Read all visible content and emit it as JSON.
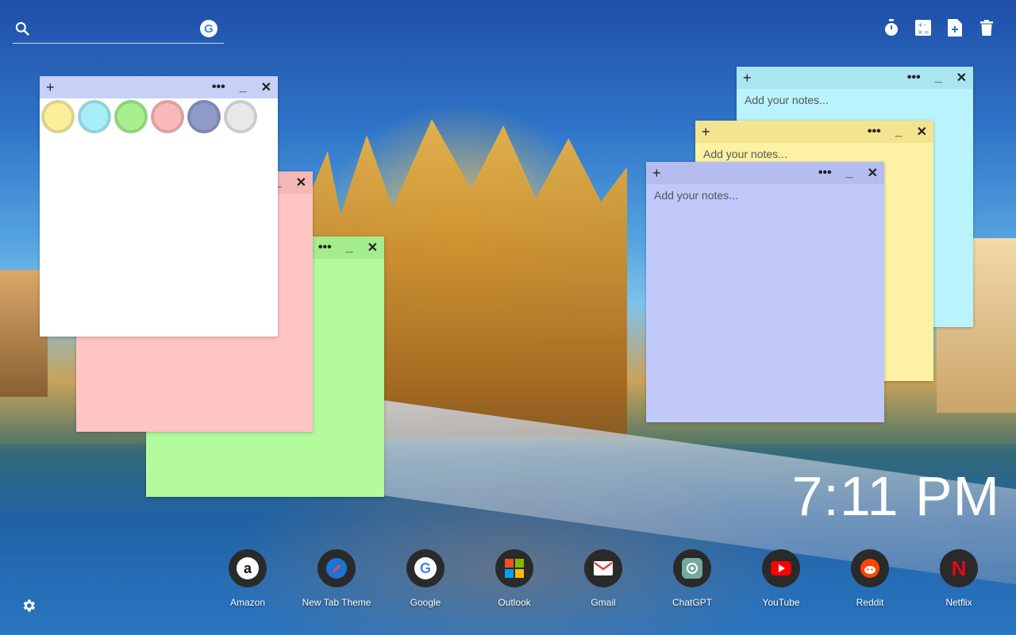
{
  "search": {
    "placeholder": ""
  },
  "top_tools": [
    "timer-icon",
    "calculator-icon",
    "add-note-icon",
    "trash-icon"
  ],
  "notes": {
    "placeholder": "Add your notes...",
    "add_symbol": "+",
    "more_symbol": "•••",
    "minimize_symbol": "_",
    "close_symbol": "✕",
    "color_options": [
      "#fbef9c",
      "#a8eef8",
      "#a6f08e",
      "#fbb8b8",
      "#8f9ac9",
      "#e8e8e8"
    ]
  },
  "clock": {
    "time": "7:11 PM"
  },
  "dock": [
    {
      "label": "Amazon",
      "icon": "amazon-icon"
    },
    {
      "label": "New Tab Theme",
      "icon": "new-tab-theme-icon"
    },
    {
      "label": "Google",
      "icon": "google-icon"
    },
    {
      "label": "Outlook",
      "icon": "outlook-icon"
    },
    {
      "label": "Gmail",
      "icon": "gmail-icon"
    },
    {
      "label": "ChatGPT",
      "icon": "chatgpt-icon"
    },
    {
      "label": "YouTube",
      "icon": "youtube-icon"
    },
    {
      "label": "Reddit",
      "icon": "reddit-icon"
    },
    {
      "label": "Netflix",
      "icon": "netflix-icon"
    }
  ]
}
